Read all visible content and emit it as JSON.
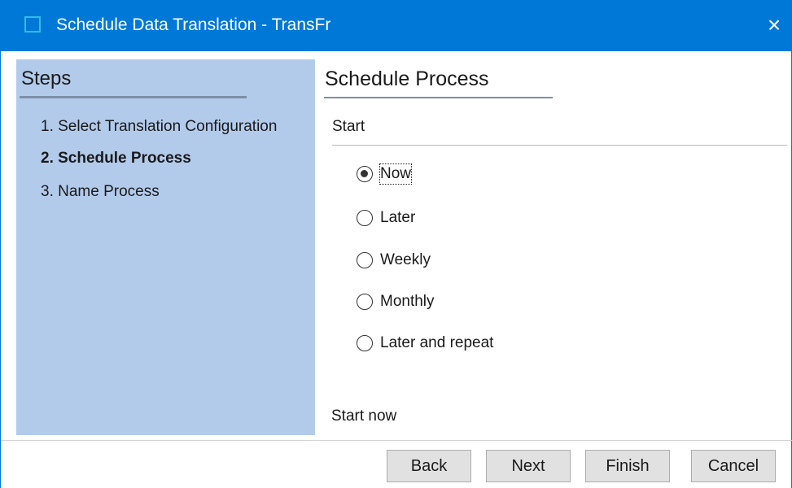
{
  "window": {
    "title": "Schedule Data Translation - TransFr",
    "close_icon": "×"
  },
  "steps": {
    "heading": "Steps",
    "items": [
      {
        "label": "1. Select Translation Configuration",
        "current": false
      },
      {
        "label": "2. Schedule Process",
        "current": true
      },
      {
        "label": "3. Name Process",
        "current": false
      }
    ]
  },
  "main": {
    "title": "Schedule Process",
    "section_label": "Start",
    "options": [
      {
        "label": "Now",
        "selected": true
      },
      {
        "label": "Later",
        "selected": false
      },
      {
        "label": "Weekly",
        "selected": false
      },
      {
        "label": "Monthly",
        "selected": false
      },
      {
        "label": "Later and repeat",
        "selected": false
      }
    ],
    "status": "Start now"
  },
  "footer": {
    "back_label": "Back",
    "next_label": "Next",
    "finish_label": "Finish",
    "cancel_label": "Cancel"
  },
  "colors": {
    "titlebar": "#0078d7",
    "steps_panel": "#b3cbeb"
  }
}
